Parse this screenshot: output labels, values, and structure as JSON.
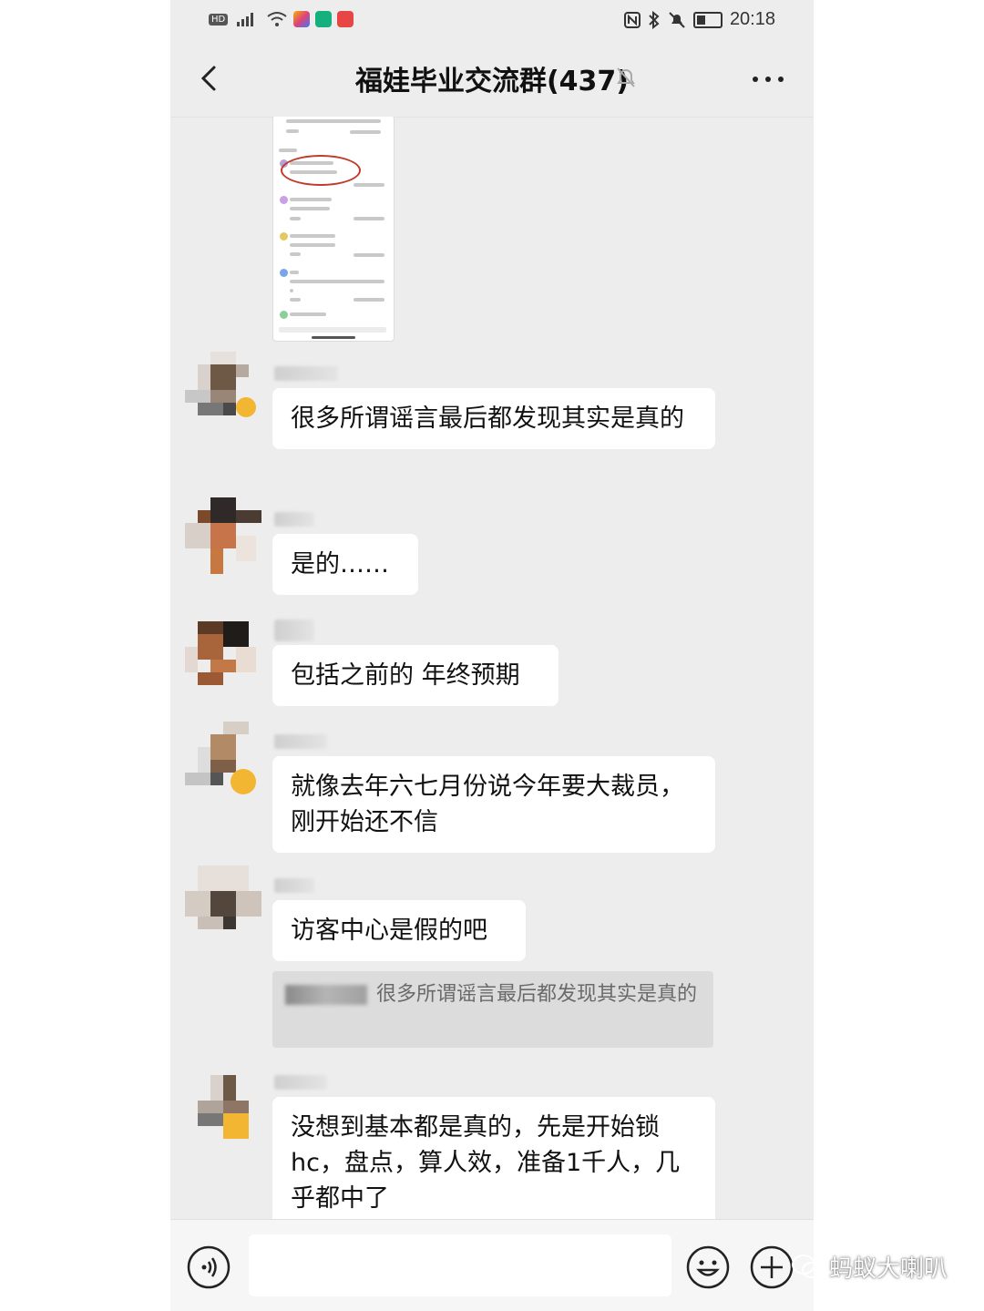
{
  "status_bar": {
    "hd": "HD",
    "time": "20:18",
    "icons": [
      "signal-icon",
      "wifi-icon",
      "nfc-icon",
      "bluetooth-icon",
      "silent-icon",
      "battery-icon"
    ]
  },
  "header": {
    "title": "福娃毕业交流群(437)",
    "back_icon": "chevron-left-icon",
    "mute_icon": "bell-off-icon",
    "more_icon": "more-dots-icon"
  },
  "messages": [
    {
      "type": "text",
      "text": "很多所谓谣言最后都发现其实是真的"
    },
    {
      "type": "text",
      "text": "是的……"
    },
    {
      "type": "text",
      "text": "包括之前的 年终预期"
    },
    {
      "type": "text",
      "text": "就像去年六七月份说今年要大裁员，刚开始还不信"
    },
    {
      "type": "text",
      "text": "访客中心是假的吧"
    },
    {
      "type": "text",
      "text": "没想到基本都是真的，先是开始锁hc，盘点，算人效，准备1千人，几乎都中了"
    }
  ],
  "quote": {
    "text": "很多所谓谣言最后都发现其实是真的"
  },
  "input_bar": {
    "voice_icon": "voice-icon",
    "emoji_icon": "emoji-icon",
    "plus_icon": "plus-icon"
  },
  "watermark": {
    "text": "蚂蚁大喇叭"
  },
  "colors": {
    "chat_bg": "#ededed",
    "bubble_bg": "#ffffff",
    "quote_bg": "#dcdcdc",
    "circle": "#c23a2a"
  }
}
